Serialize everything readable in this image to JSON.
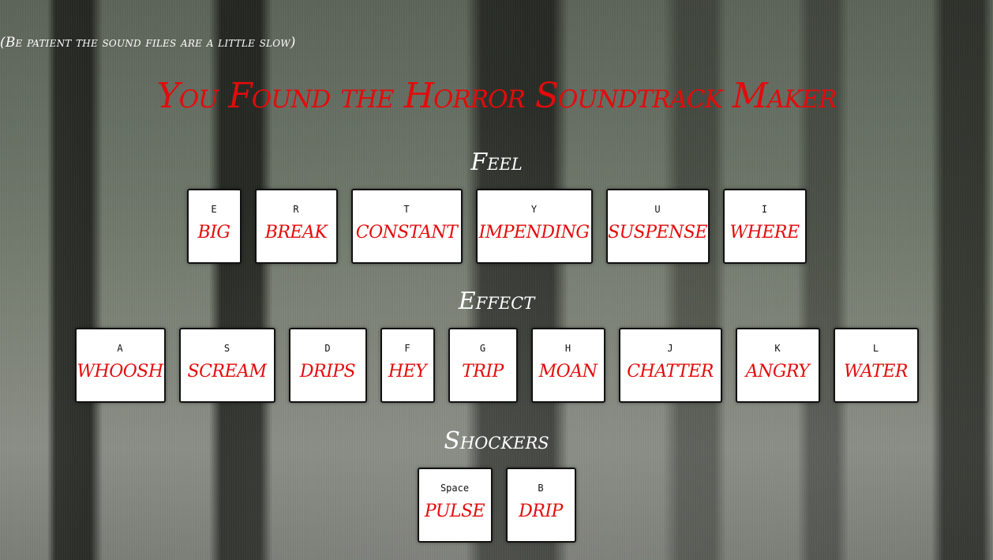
{
  "notice": "(Be patient the sound files are a little slow)",
  "title": "You Found the Horror Soundtrack Maker",
  "sections": {
    "feel": {
      "heading": "Feel",
      "keys": [
        {
          "key": "E",
          "sound": "big"
        },
        {
          "key": "R",
          "sound": "break"
        },
        {
          "key": "T",
          "sound": "constant"
        },
        {
          "key": "Y",
          "sound": "impending"
        },
        {
          "key": "U",
          "sound": "suspense"
        },
        {
          "key": "I",
          "sound": "where"
        }
      ]
    },
    "effect": {
      "heading": "Effect",
      "keys": [
        {
          "key": "A",
          "sound": "whoosh"
        },
        {
          "key": "S",
          "sound": "scream"
        },
        {
          "key": "D",
          "sound": "drips"
        },
        {
          "key": "F",
          "sound": "hey"
        },
        {
          "key": "G",
          "sound": "trip"
        },
        {
          "key": "H",
          "sound": "moan"
        },
        {
          "key": "J",
          "sound": "chatter"
        },
        {
          "key": "K",
          "sound": "angry"
        },
        {
          "key": "L",
          "sound": "water"
        }
      ]
    },
    "shockers": {
      "heading": "Shockers",
      "keys": [
        {
          "key": "Space",
          "sound": "pulse"
        },
        {
          "key": "B",
          "sound": "drip"
        }
      ]
    }
  },
  "colors": {
    "title_red": "#e30b0b",
    "key_background": "#ffffff",
    "heading_white": "#ffffff"
  }
}
